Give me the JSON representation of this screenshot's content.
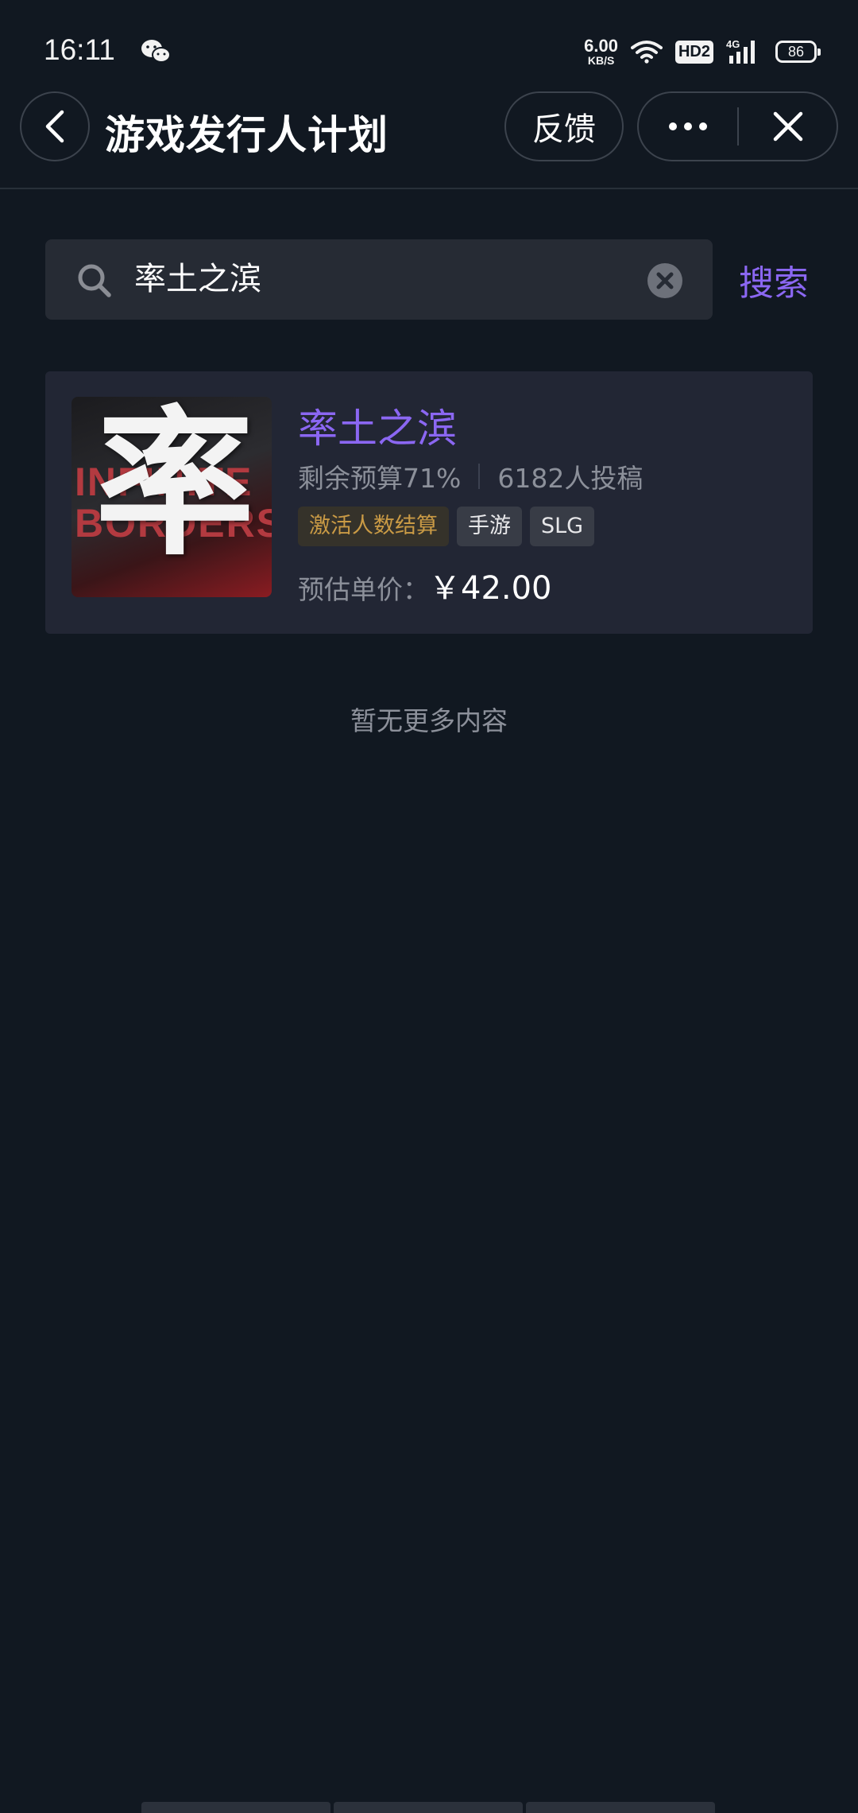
{
  "status_bar": {
    "time": "16:11",
    "net_speed_value": "6.00",
    "net_speed_unit": "KB/S",
    "hd_label": "HD2",
    "network_label": "4G",
    "battery_level": "86"
  },
  "header": {
    "title": "游戏发行人计划",
    "feedback_label": "反馈"
  },
  "search": {
    "value": "率土之滨",
    "button_label": "搜索"
  },
  "results": [
    {
      "name": "率土之滨",
      "thumb_text_line1": "INFINITE",
      "thumb_text_line2": "BORDERS",
      "thumb_char": "率",
      "budget": "剩余预算71%",
      "submissions": "6182人投稿",
      "tags": [
        "激活人数结算",
        "手游",
        "SLG"
      ],
      "price_label": "预估单价：",
      "price_value": "￥42.00"
    }
  ],
  "footer": {
    "no_more_text": "暂无更多内容"
  },
  "colors": {
    "background": "#111821",
    "accent": "#8b67f2",
    "card": "#222634",
    "tag_gold": "#c99a45"
  }
}
